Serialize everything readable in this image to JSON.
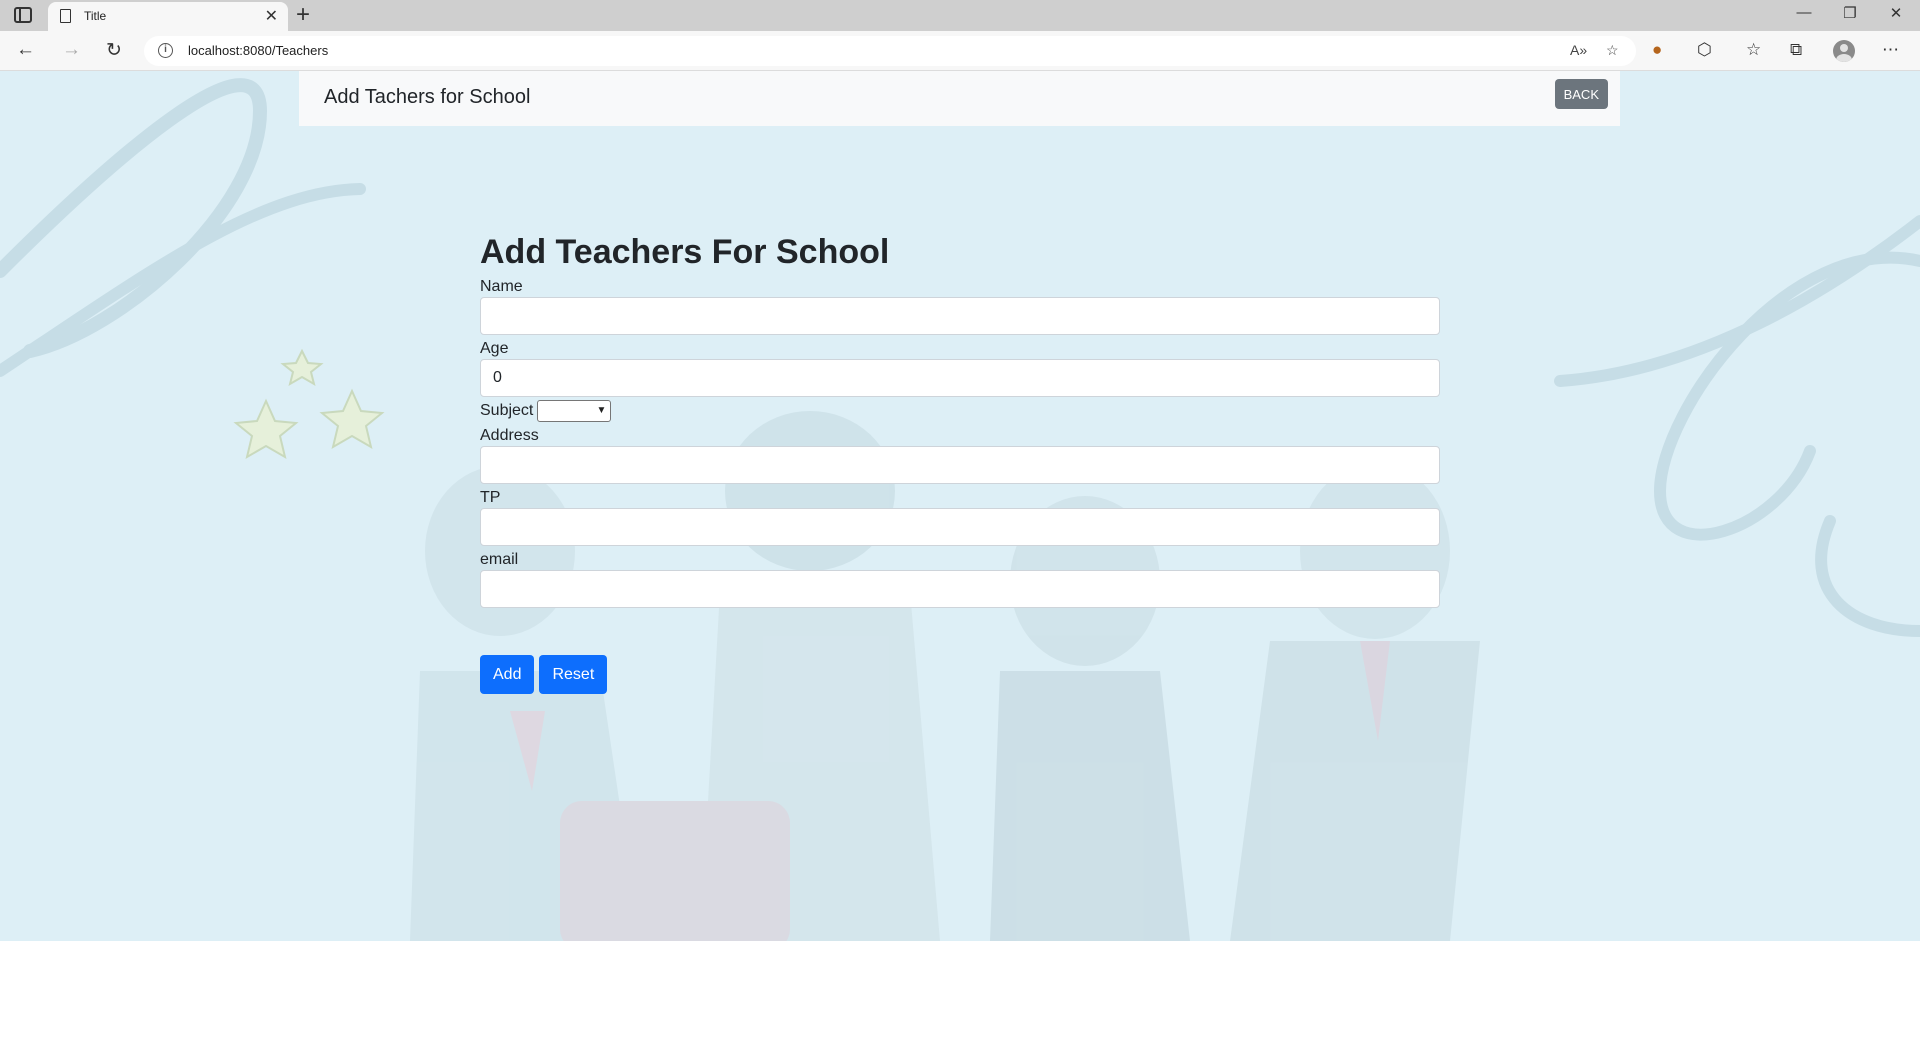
{
  "browser": {
    "tab_title": "Title",
    "url": "localhost:8080/Teachers",
    "icons": [
      "tab-actions-icon",
      "page-icon",
      "close-icon",
      "plus-icon",
      "minimize-icon",
      "restore-icon",
      "close-window-icon",
      "back-icon",
      "forward-icon",
      "reload-icon",
      "info-icon",
      "read-aloud-icon",
      "favorite-add-icon",
      "cookie-extension-icon",
      "extensions-icon",
      "favorites-icon",
      "collections-icon",
      "profile-icon",
      "more-icon"
    ]
  },
  "navbar": {
    "title": "Add Tachers for School",
    "back_label": "BACK"
  },
  "form": {
    "heading": "Add Teachers For School",
    "name_label": "Name",
    "name_value": "",
    "age_label": "Age",
    "age_value": "0",
    "subject_label": "Subject",
    "subject_value": "",
    "address_label": "Address",
    "address_value": "",
    "tp_label": "TP",
    "tp_value": "",
    "email_label": "email",
    "email_value": "",
    "add_label": "Add",
    "reset_label": "Reset"
  },
  "colors": {
    "page_bg": "#ddeff6",
    "navbar_bg": "#f8f9fa",
    "primary": "#0d6efd",
    "secondary": "#6c757d"
  }
}
